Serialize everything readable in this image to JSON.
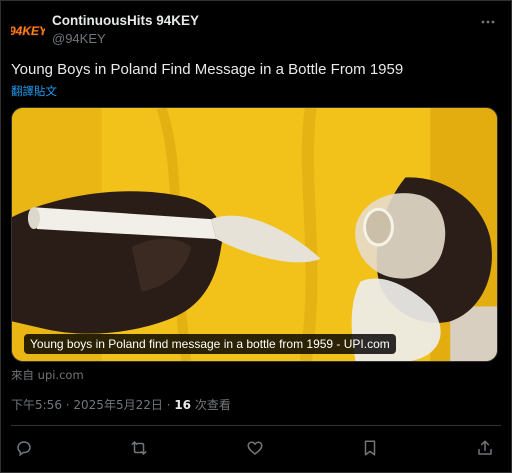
{
  "author": {
    "display_name": "ContinuousHits 94KEY",
    "handle": "@94KEY",
    "avatar_logo_text": "94KEY",
    "avatar_logo_color": "#e8a31c"
  },
  "tweet": {
    "text": "Young Boys in Poland Find Message in a Bottle From 1959",
    "translate_label": "翻譯貼文"
  },
  "media": {
    "caption": "Young boys in Poland find message in a bottle from 1959 - UPI.com",
    "source_label": "來自 upi.com"
  },
  "meta": {
    "time": "下午5:56",
    "separator1": " · ",
    "date": "2025年5月22日",
    "separator2": " · ",
    "views_count": "16",
    "views_label": " 次查看"
  },
  "actions": [
    {
      "icon": "reply-icon"
    },
    {
      "icon": "retweet-icon"
    },
    {
      "icon": "like-icon"
    },
    {
      "icon": "bookmark-icon"
    },
    {
      "icon": "share-icon"
    }
  ],
  "colors": {
    "background": "#000000",
    "text_primary": "#e7e9ea",
    "text_secondary": "#71767b",
    "link": "#1d9bf0",
    "border": "#2f3336"
  }
}
